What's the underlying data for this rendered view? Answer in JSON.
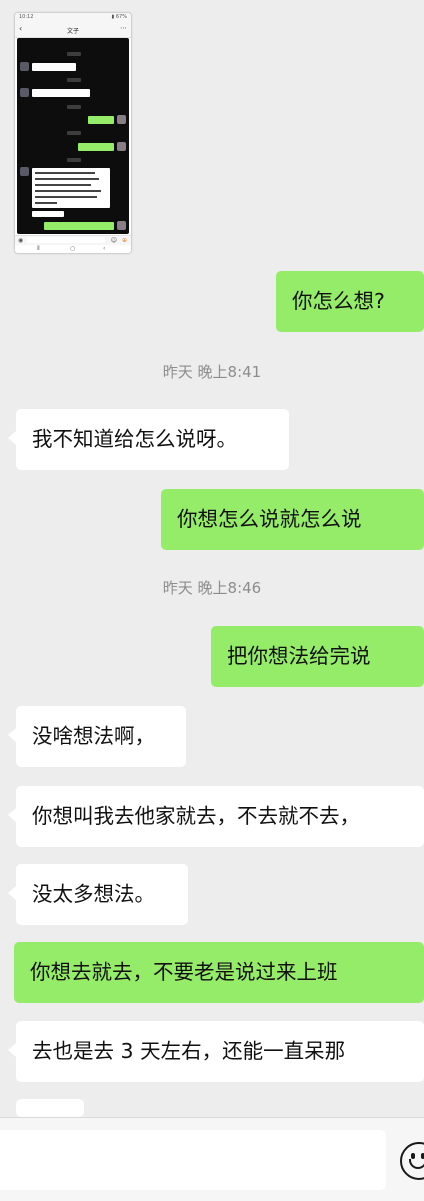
{
  "thumbnail": {
    "status_time": "10:12",
    "status_right": "▮ 67%",
    "title": "文子",
    "back_icon": "chevron-left-icon",
    "more_icon": "more-icon"
  },
  "timestamps": [
    "昨天 晚上8:41",
    "昨天 晚上8:46"
  ],
  "messages": [
    {
      "side": "right",
      "text": "你怎么想?"
    },
    {
      "side": "left",
      "text": "我不知道给怎么说呀。"
    },
    {
      "side": "right",
      "text": "你想怎么说就怎么说"
    },
    {
      "side": "right",
      "text": "把你想法给完说"
    },
    {
      "side": "left",
      "text": "没啥想法啊，"
    },
    {
      "side": "left",
      "text": "你想叫我去他家就去，不去就不去，"
    },
    {
      "side": "left",
      "text": "没太多想法。"
    },
    {
      "side": "right",
      "text": "你想去就去，不要老是说过来上班"
    },
    {
      "side": "left",
      "text": "去也是去 3 天左右，还能一直呆那"
    }
  ],
  "input_bar": {
    "placeholder": "",
    "emoji_icon": "emoji-icon"
  },
  "colors": {
    "background": "#ededed",
    "bubble_self": "#95ec69",
    "bubble_other": "#ffffff",
    "timestamp_text": "#8d8d8d"
  }
}
